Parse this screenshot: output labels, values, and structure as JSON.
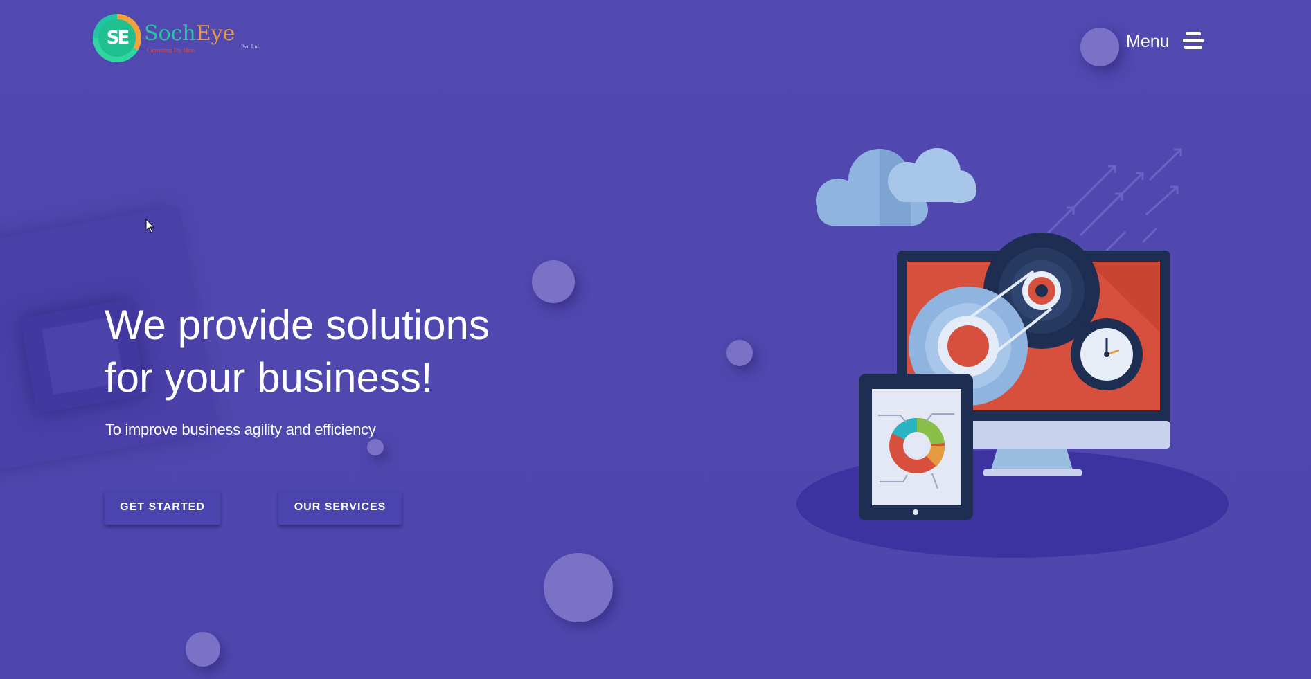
{
  "header": {
    "logo": {
      "mark_text": "SE",
      "word_part1": "Soch",
      "word_part2": "Eye",
      "tagline": "Converting Thy Ideas",
      "suffix": "Pvt. Ltd."
    },
    "menu_label": "Menu"
  },
  "hero": {
    "title_line1": "We provide solutions",
    "title_line2": "for your business!",
    "subtitle": "To improve business agility and efficiency",
    "primary_button": "GET STARTED",
    "secondary_button": "OUR SERVICES"
  },
  "colors": {
    "background": "#5048ad",
    "bubble": "#7b72c8",
    "button_bg": "#4b44ae",
    "accent_green": "#28c7a0",
    "accent_orange": "#e69a40"
  },
  "icons": {
    "menu": "hamburger-menu-icon",
    "illustration": "cloud-computing-gears-monitor-tablet-illustration",
    "cursor": "mouse-pointer-icon"
  }
}
